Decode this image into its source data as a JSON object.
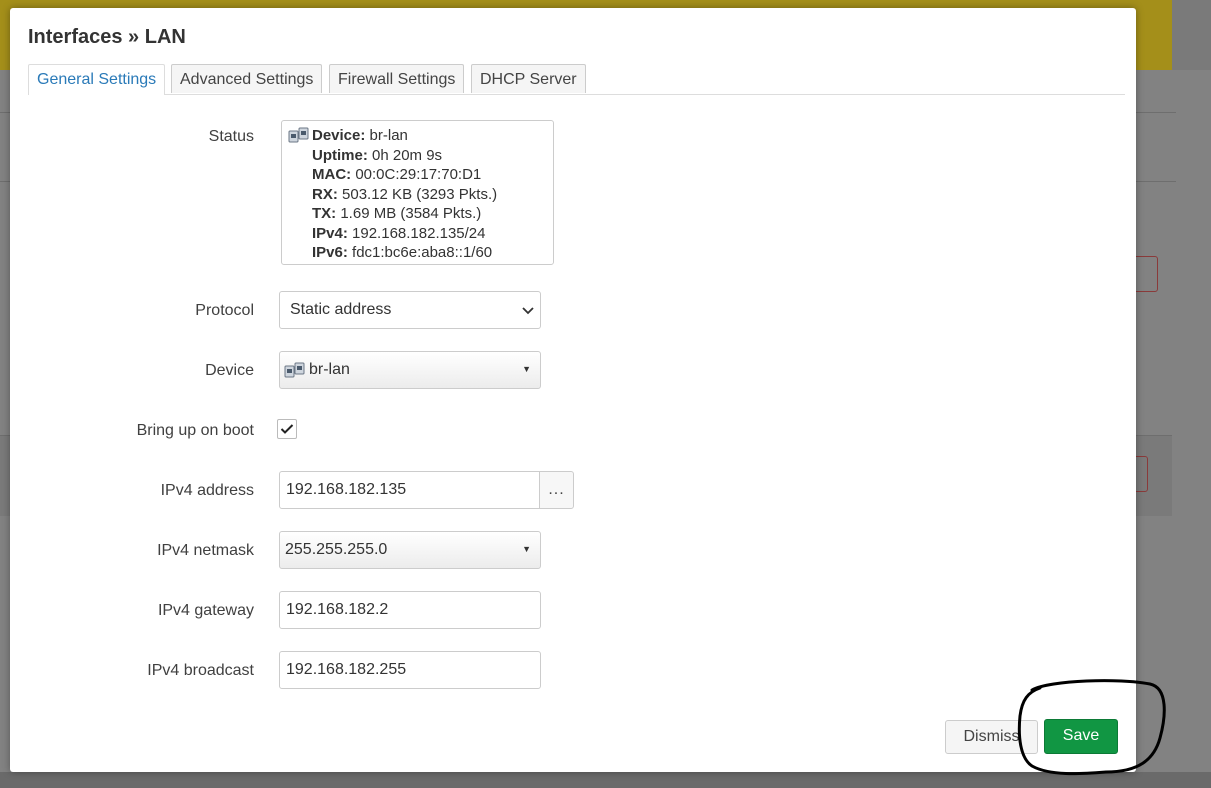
{
  "modal": {
    "title": "Interfaces » LAN",
    "tabs": [
      {
        "label": "General Settings",
        "active": true
      },
      {
        "label": "Advanced Settings",
        "active": false
      },
      {
        "label": "Firewall Settings",
        "active": false
      },
      {
        "label": "DHCP Server",
        "active": false
      }
    ]
  },
  "status": {
    "label": "Status",
    "icon": "ethernet-ports-icon",
    "lines": [
      {
        "key": "Device:",
        "value": "br-lan"
      },
      {
        "key": "Uptime:",
        "value": "0h 20m 9s"
      },
      {
        "key": "MAC:",
        "value": "00:0C:29:17:70:D1"
      },
      {
        "key": "RX:",
        "value": "503.12 KB (3293 Pkts.)"
      },
      {
        "key": "TX:",
        "value": "1.69 MB (3584 Pkts.)"
      },
      {
        "key": "IPv4:",
        "value": "192.168.182.135/24"
      },
      {
        "key": "IPv6:",
        "value": "fdc1:bc6e:aba8::1/60"
      }
    ]
  },
  "form": {
    "protocol": {
      "label": "Protocol",
      "value": "Static address"
    },
    "device": {
      "label": "Device",
      "value": "br-lan"
    },
    "boot": {
      "label": "Bring up on boot",
      "checked": true
    },
    "ipv4_address": {
      "label": "IPv4 address",
      "value": "192.168.182.135",
      "more_label": "..."
    },
    "ipv4_netmask": {
      "label": "IPv4 netmask",
      "value": "255.255.255.0"
    },
    "ipv4_gateway": {
      "label": "IPv4 gateway",
      "value": "192.168.182.2"
    },
    "ipv4_broadcast": {
      "label": "IPv4 broadcast",
      "value": "192.168.182.255"
    }
  },
  "footer": {
    "dismiss_label": "Dismiss",
    "save_label": "Save"
  },
  "colors": {
    "accent": "#2a7ab8",
    "save_button": "#119643",
    "annotation_stroke": "#000000"
  }
}
